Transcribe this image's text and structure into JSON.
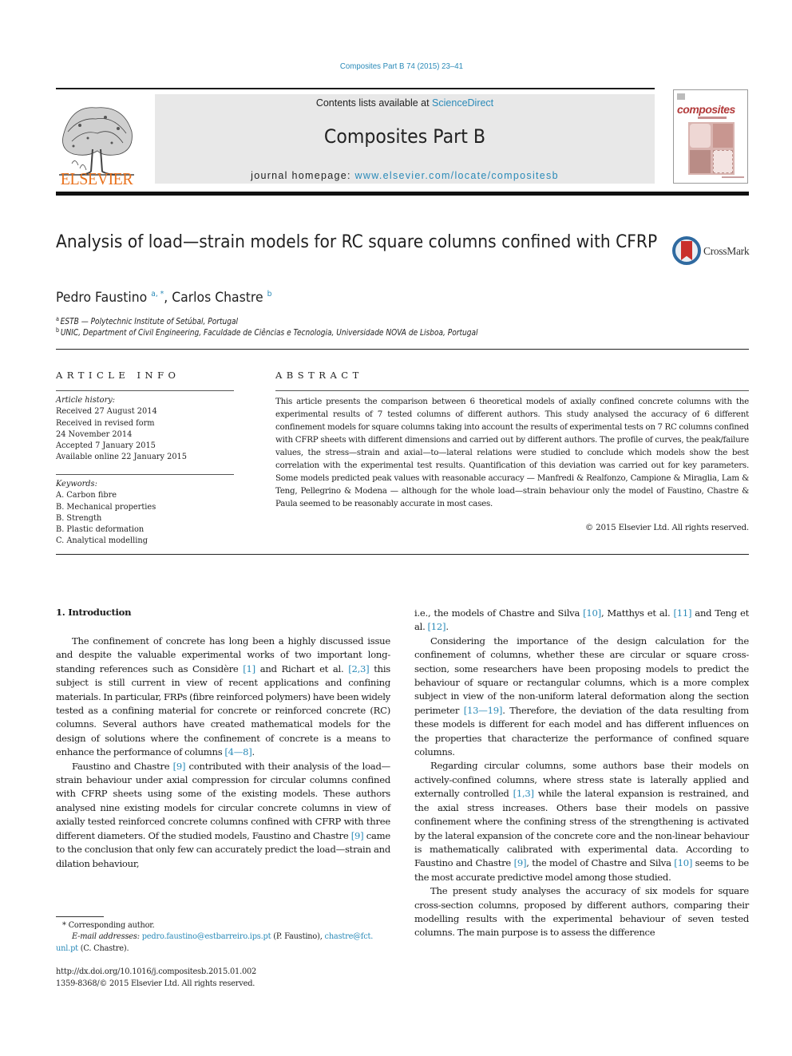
{
  "header": {
    "journal_ref": "Composites Part B 74 (2015) 23–41",
    "contents_prefix": "Contents lists available at ",
    "contents_link": "ScienceDirect",
    "journal_title": "Composites Part B",
    "homepage_prefix": "journal homepage: ",
    "homepage_link": "www.elsevier.com/locate/compositesb",
    "publisher_logo": "ELSEVIER",
    "cover_word": "composites"
  },
  "article": {
    "title": "Analysis of load—strain models for RC square columns confined with CFRP",
    "crossmark_label": "CrossMark",
    "authors": [
      {
        "name": "Pedro Faustino",
        "sup": "a, *"
      },
      {
        "name": "Carlos Chastre",
        "sup": "b"
      }
    ],
    "affiliations": [
      {
        "key": "a",
        "text": "ESTB — Polytechnic Institute of Setúbal, Portugal"
      },
      {
        "key": "b",
        "text": "UNIC, Department of Civil Engineering, Faculdade de Ciências e Tecnologia, Universidade NOVA de Lisboa, Portugal"
      }
    ]
  },
  "article_info": {
    "heading": "ARTICLE INFO",
    "history_label": "Article history:",
    "history": [
      "Received 27 August 2014",
      "Received in revised form",
      "24 November 2014",
      "Accepted 7 January 2015",
      "Available online 22 January 2015"
    ],
    "keywords_label": "Keywords:",
    "keywords": [
      "A. Carbon fibre",
      "B. Mechanical properties",
      "B. Strength",
      "B. Plastic deformation",
      "C. Analytical modelling"
    ]
  },
  "abstract": {
    "heading": "ABSTRACT",
    "text": "This article presents the comparison between 6 theoretical models of axially confined concrete columns with the experimental results of 7 tested columns of different authors. This study analysed the accuracy of 6 different confinement models for square columns taking into account the results of experimental tests on 7 RC columns confined with CFRP sheets with different dimensions and carried out by different authors. The profile of curves, the peak/failure values, the stress—strain and axial—to—lateral relations were studied to conclude which models show the best correlation with the experimental test results. Quantification of this deviation was carried out for key parameters. Some models predicted peak values with reasonable accuracy — Manfredi & Realfonzo, Campione & Miraglia, Lam & Teng, Pellegrino & Modena — although for the whole load—strain behaviour only the model of Faustino, Chastre & Paula seemed to be reasonably accurate in most cases.",
    "copyright": "© 2015 Elsevier Ltd. All rights reserved."
  },
  "body": {
    "section_heading": "1.  Introduction",
    "left": [
      {
        "segments": [
          {
            "t": "The confinement of concrete has long been a highly discussed issue and despite the valuable experimental works of two important long-standing references such as Considère "
          },
          {
            "r": "[1]"
          },
          {
            "t": " and Richart et al. "
          },
          {
            "r": "[2,3]"
          },
          {
            "t": " this subject is still current in view of recent applications and confining materials. In particular, FRPs (fibre reinforced polymers) have been widely tested as a confining material for concrete or reinforced concrete (RC) columns. Several authors have created mathematical models for the design of solutions where the confinement of concrete is a means to enhance the performance of columns "
          },
          {
            "r": "[4—8]"
          },
          {
            "t": "."
          }
        ]
      },
      {
        "segments": [
          {
            "t": "Faustino and Chastre "
          },
          {
            "r": "[9]"
          },
          {
            "t": " contributed with their analysis of the load—strain behaviour under axial compression for circular columns confined with CFRP sheets using some of the existing models. These authors analysed nine existing models for circular concrete columns in view of axially tested reinforced concrete columns confined with CFRP with three different diameters. Of the studied models, Faustino and Chastre "
          },
          {
            "r": "[9]"
          },
          {
            "t": " came to the conclusion that only few can accurately predict the load—strain and dilation behaviour,"
          }
        ]
      }
    ],
    "right": [
      {
        "noindent": true,
        "segments": [
          {
            "t": "i.e., the models of Chastre and Silva "
          },
          {
            "r": "[10]"
          },
          {
            "t": ", Matthys et al. "
          },
          {
            "r": "[11]"
          },
          {
            "t": " and Teng et al. "
          },
          {
            "r": "[12]"
          },
          {
            "t": "."
          }
        ]
      },
      {
        "segments": [
          {
            "t": "Considering the importance of the design calculation for the confinement of columns, whether these are circular or square cross-section, some researchers have been proposing models to predict the behaviour of square or rectangular columns, which is a more complex subject in view of the non-uniform lateral deformation along the section perimeter "
          },
          {
            "r": "[13—19]"
          },
          {
            "t": ". Therefore, the deviation of the data resulting from these models is different for each model and has different influences on the properties that characterize the performance of confined square columns."
          }
        ]
      },
      {
        "segments": [
          {
            "t": "Regarding circular columns, some authors base their models on actively-confined columns, where stress state is laterally applied and externally controlled "
          },
          {
            "r": "[1,3]"
          },
          {
            "t": " while the lateral expansion is restrained, and the axial stress increases. Others base their models on passive confinement where the confining stress of the strengthening is activated by the lateral expansion of the concrete core and the non-linear behaviour is mathematically calibrated with experimental data. According to Faustino and Chastre "
          },
          {
            "r": "[9]"
          },
          {
            "t": ", the model of Chastre and Silva "
          },
          {
            "r": "[10]"
          },
          {
            "t": " seems to be the most accurate predictive model among those studied."
          }
        ]
      },
      {
        "segments": [
          {
            "t": "The present study analyses the accuracy of six models for square cross-section columns, proposed by different authors, comparing their modelling results with the experimental behaviour of seven tested columns. The main purpose is to assess the difference"
          }
        ]
      }
    ]
  },
  "footnotes": {
    "corresponding": "* Corresponding author.",
    "email_label": "E-mail addresses: ",
    "email1": "pedro.faustino@estbarreiro.ips.pt",
    "email1_who": " (P. Faustino), ",
    "email2_part1": "chastre@fct.",
    "email2_part2": "unl.pt",
    "email2_who": " (C. Chastre).",
    "doi": "http://dx.doi.org/10.1016/j.compositesb.2015.01.002",
    "issn": "1359-8368/© 2015 Elsevier Ltd. All rights reserved."
  }
}
